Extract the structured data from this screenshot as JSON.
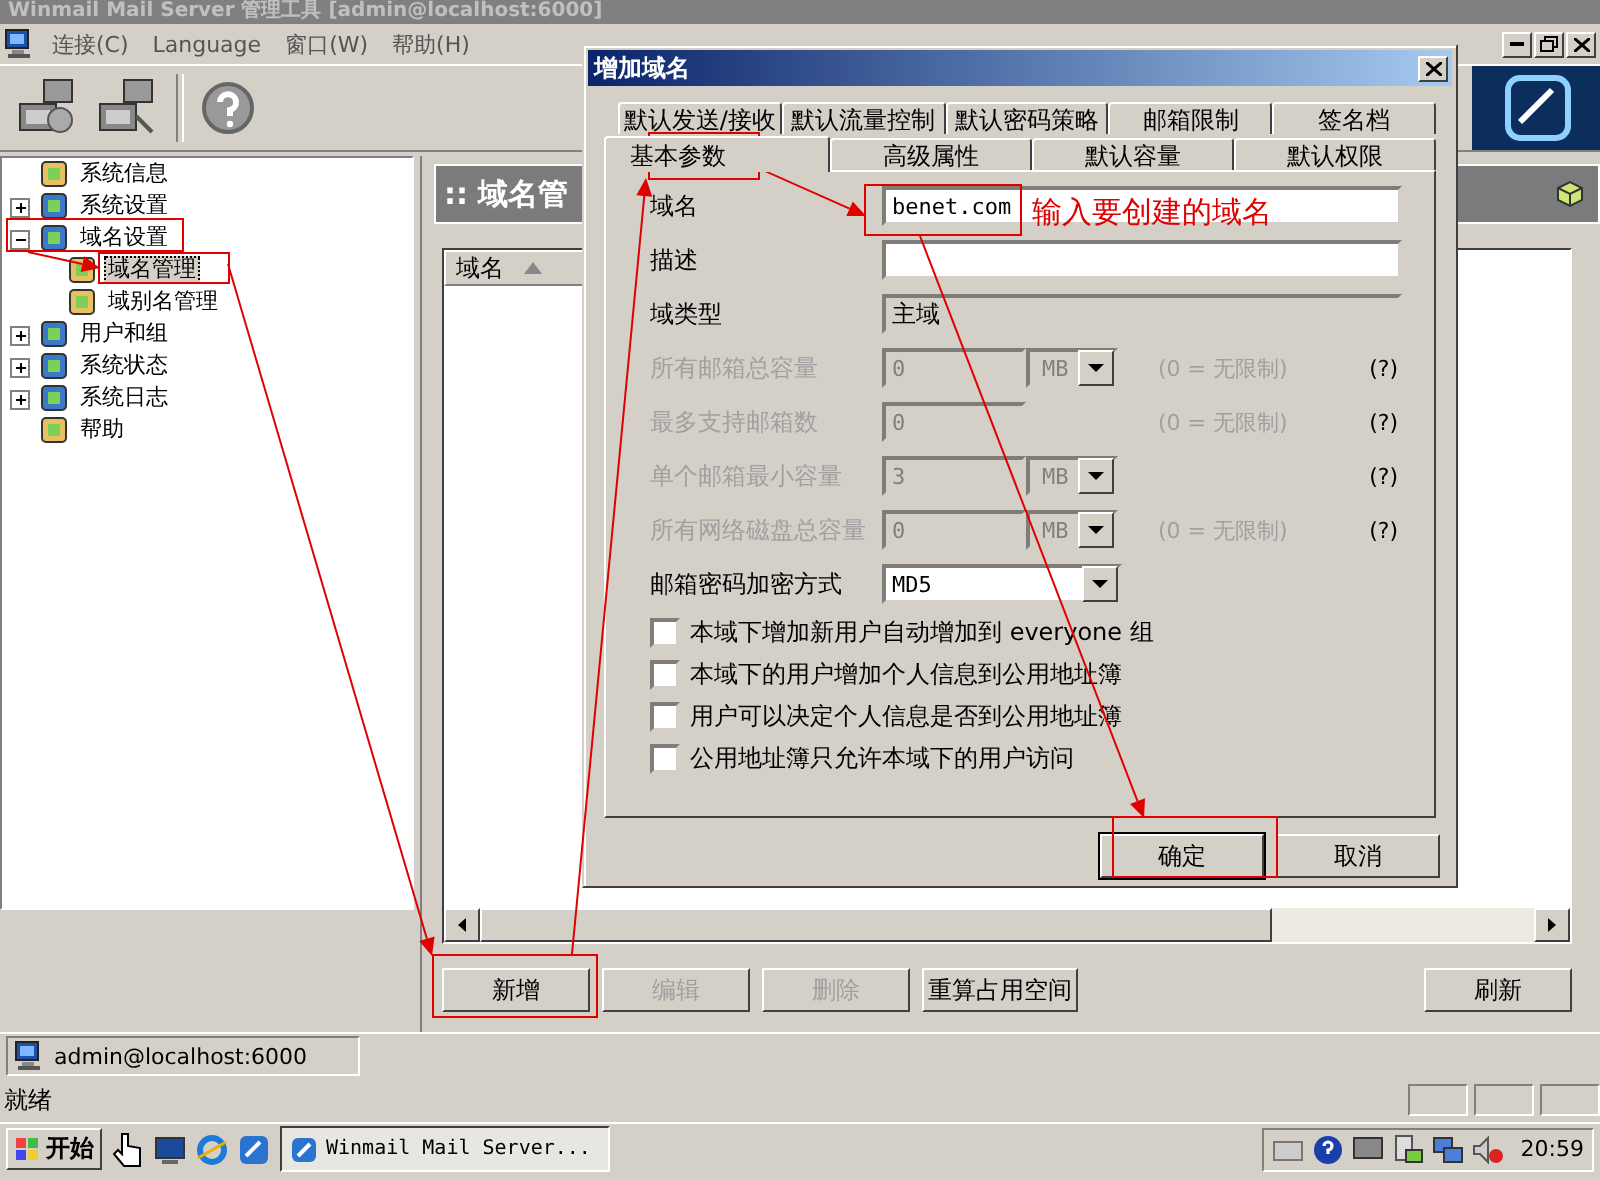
{
  "window": {
    "title": "Winmail Mail Server  管理工具  [admin@localhost:6000]"
  },
  "menu": [
    {
      "label": "连接(C)"
    },
    {
      "label": "Language"
    },
    {
      "label": "窗口(W)"
    },
    {
      "label": "帮助(H)"
    }
  ],
  "tree": [
    {
      "label": "系统信息",
      "kind": "leaf",
      "selected": false
    },
    {
      "label": "系统设置",
      "kind": "folder",
      "expanded": false,
      "selected": false
    },
    {
      "label": "域名设置",
      "kind": "folder",
      "expanded": true,
      "selected": false,
      "children": [
        {
          "label": "域名管理",
          "kind": "leaf",
          "selected": true
        },
        {
          "label": "域别名管理",
          "kind": "leaf",
          "selected": false
        }
      ]
    },
    {
      "label": "用户和组",
      "kind": "folder",
      "expanded": false,
      "selected": false
    },
    {
      "label": "系统状态",
      "kind": "folder",
      "expanded": false,
      "selected": false
    },
    {
      "label": "系统日志",
      "kind": "folder",
      "expanded": false,
      "selected": false
    },
    {
      "label": "帮助",
      "kind": "leaf",
      "selected": false
    }
  ],
  "panel": {
    "title": ":: 域名管",
    "columns": [
      {
        "label": "域名"
      }
    ],
    "buttons": [
      {
        "label": "新增",
        "disabled": false
      },
      {
        "label": "编辑",
        "disabled": true
      },
      {
        "label": "删除",
        "disabled": true
      },
      {
        "label": "重算占用空间",
        "disabled": false
      },
      {
        "label": "刷新",
        "disabled": false
      }
    ]
  },
  "status_bar": {
    "connection": "admin@localhost:6000",
    "message": "就绪"
  },
  "taskbar": {
    "start": "开始",
    "tasks": [
      {
        "label": "Winmail Mail Server...",
        "selected": true
      }
    ],
    "clock": "20:59"
  },
  "dialog": {
    "title": "增加域名",
    "tab_rows": [
      [
        {
          "label": "默认发送/接收",
          "selected": false
        },
        {
          "label": "默认流量控制",
          "selected": false
        },
        {
          "label": "默认密码策略",
          "selected": false
        },
        {
          "label": "邮箱限制",
          "selected": false
        },
        {
          "label": "签名档",
          "selected": false
        }
      ],
      [
        {
          "label": "基本参数",
          "selected": true
        },
        {
          "label": "高级属性",
          "selected": false
        },
        {
          "label": "默认容量",
          "selected": false
        },
        {
          "label": "默认权限",
          "selected": false
        }
      ]
    ],
    "fields": [
      {
        "kind": "text",
        "label": "域名",
        "value": "benet.com",
        "disabled": false
      },
      {
        "kind": "text",
        "label": "描述",
        "disabled": false
      },
      {
        "kind": "readonly",
        "label": "域类型",
        "value": "主域",
        "disabled": false
      },
      {
        "kind": "number",
        "label": "所有邮箱总容量",
        "value": "0",
        "unit": "MB",
        "hint": "(0 = 无限制)",
        "help": "(?)",
        "disabled": true
      },
      {
        "kind": "number",
        "label": "最多支持邮箱数",
        "value": "0",
        "hint": "(0 = 无限制)",
        "help": "(?)",
        "disabled": true
      },
      {
        "kind": "number",
        "label": "单个邮箱最小容量",
        "value": "3",
        "unit": "MB",
        "help": "(?)",
        "disabled": true
      },
      {
        "kind": "number",
        "label": "所有网络磁盘总容量",
        "value": "0",
        "unit": "MB",
        "hint": "(0 = 无限制)",
        "help": "(?)",
        "disabled": true
      },
      {
        "kind": "select",
        "label": "邮箱密码加密方式",
        "value": "MD5",
        "disabled": false
      }
    ],
    "checkboxes": [
      {
        "label": "本域下增加新用户自动增加到 everyone 组",
        "checked": false
      },
      {
        "label": "本域下的用户增加个人信息到公用地址簿",
        "checked": false
      },
      {
        "label": "用户可以决定个人信息是否到公用地址簿",
        "checked": false
      },
      {
        "label": "公用地址簿只允许本域下的用户访问",
        "checked": false
      }
    ],
    "buttons": [
      {
        "label": "确定",
        "default": true
      },
      {
        "label": "取消",
        "default": false
      }
    ]
  },
  "annotation": {
    "text": "输入要创建的域名"
  }
}
